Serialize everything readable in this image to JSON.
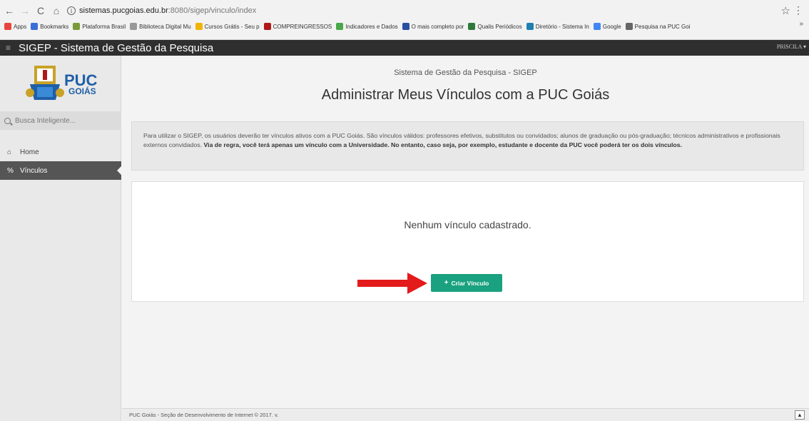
{
  "browser": {
    "url_host": "sistemas.pucgoias.edu.br",
    "url_path": ":8080/sigep/vinculo/index",
    "bookmarks": [
      {
        "label": "Apps",
        "color": "#e8453c"
      },
      {
        "label": "Bookmarks",
        "color": "#3b6fd8"
      },
      {
        "label": "Plataforma Brasil",
        "color": "#7a9a3a"
      },
      {
        "label": "Biblioteca Digital Mu",
        "color": "#999999"
      },
      {
        "label": "Cursos Grátis - Seu p",
        "color": "#f0b400"
      },
      {
        "label": "COMPREINGRESSOS",
        "color": "#b01818"
      },
      {
        "label": "Indicadores e Dados",
        "color": "#4aa84a"
      },
      {
        "label": "O mais completo por",
        "color": "#2a4fa0"
      },
      {
        "label": "Qualis Periódicos",
        "color": "#2d7a3a"
      },
      {
        "label": "Diretório - Sistema In",
        "color": "#1f7fb0"
      },
      {
        "label": "Google",
        "color": "#4285f4"
      },
      {
        "label": "Pesquisa na PUC Goi",
        "color": "#666666"
      }
    ],
    "bookmark_overflow": "»"
  },
  "header": {
    "menu_icon": "≡",
    "title": "SIGEP - Sistema de Gestão da Pesquisa",
    "user": "PRISCILA"
  },
  "sidebar": {
    "search_placeholder": "Busca Inteligente...",
    "items": [
      {
        "label": "Home",
        "icon": "home-icon"
      },
      {
        "label": "Vínculos",
        "icon": "link-icon",
        "active": true
      }
    ]
  },
  "main": {
    "subtitle": "Sistema de Gestão da Pesquisa - SIGEP",
    "title": "Administrar Meus Vínculos com a PUC Goiás",
    "info_text": "Para utilizar o SIGEP, os usuários deverão ter vínculos ativos com a PUC Goiás. São vínculos válidos: professores efetivos, substitutos ou convidados; alunos de graduação ou pós-graduação; técnicos administrativos e profissionais externos convidados. ",
    "info_bold": "Via de regra, você terá apenas um vínculo com a Universidade. No entanto, caso seja, por exemplo, estudante e docente da PUC você poderá ter os dois vínculos.",
    "empty_message": "Nenhum vínculo cadastrado.",
    "create_button": "Criar Vínculo",
    "accent_color": "#1aa17f"
  },
  "footer": {
    "text": "PUC Goiás - Seção de Desenvolvimento de Internet © 2017. v."
  }
}
